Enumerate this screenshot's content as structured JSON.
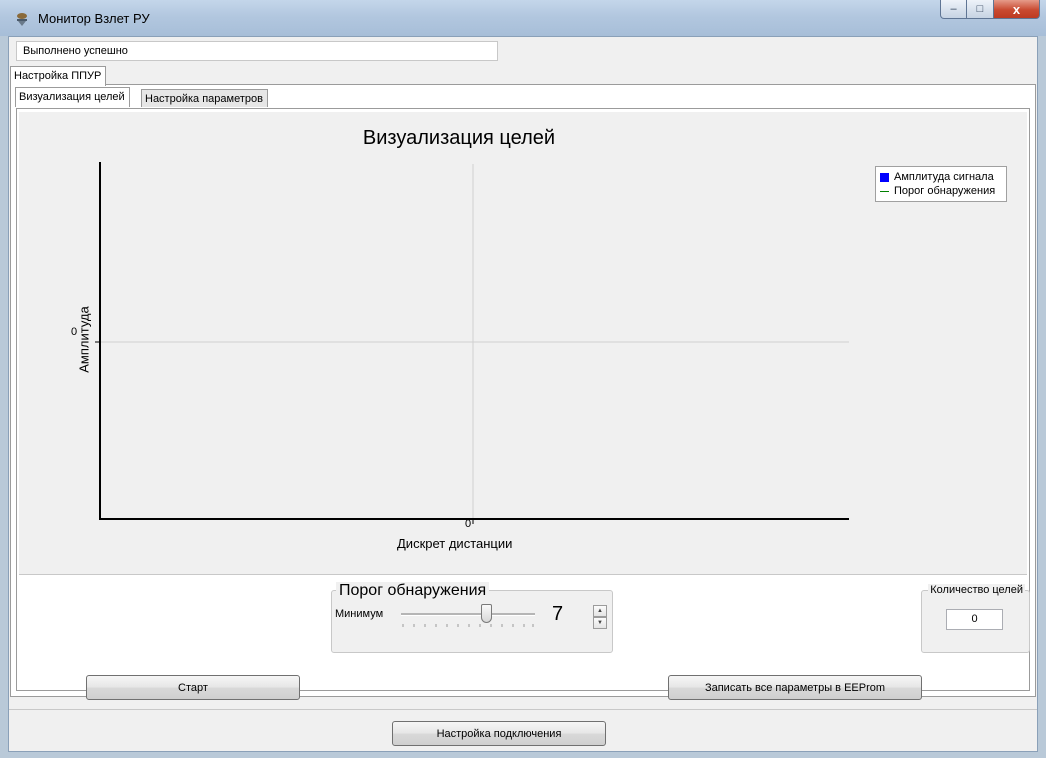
{
  "window": {
    "title": "Монитор Взлет РУ",
    "controls": {
      "minimize": "–",
      "maximize": "□",
      "close": "x"
    }
  },
  "status": {
    "text": "Выполнено успешно"
  },
  "tabs": {
    "outer": [
      {
        "label": "Настройка ППУР",
        "selected": true
      }
    ],
    "inner": [
      {
        "label": "Визуализация целей",
        "selected": true
      },
      {
        "label": "Настройка параметров",
        "selected": false
      }
    ]
  },
  "chart_data": {
    "type": "bar",
    "title": "Визуализация целей",
    "xlabel": "Дискрет дистанции",
    "ylabel": "Амплитуда",
    "x_ticks": [
      "0"
    ],
    "y_ticks": [
      "0"
    ],
    "series": [
      {
        "name": "Амплитуда сигнала",
        "color": "#0000ff",
        "values": []
      },
      {
        "name": "Порог обнаружения",
        "color": "#008000",
        "values": []
      }
    ],
    "legend": "top-right",
    "grid": true
  },
  "threshold": {
    "title": "Порог обнаружения",
    "label": "Минимум",
    "value": "7",
    "slider_fraction": 0.64
  },
  "target_count": {
    "title": "Количество целей",
    "value": "0"
  },
  "buttons": {
    "start": "Старт",
    "write_eeprom": "Записать все параметры в EEProm",
    "connection_settings": "Настройка подключения"
  },
  "colors": {
    "accent": "#0000ff",
    "threshold_line": "#008000"
  }
}
